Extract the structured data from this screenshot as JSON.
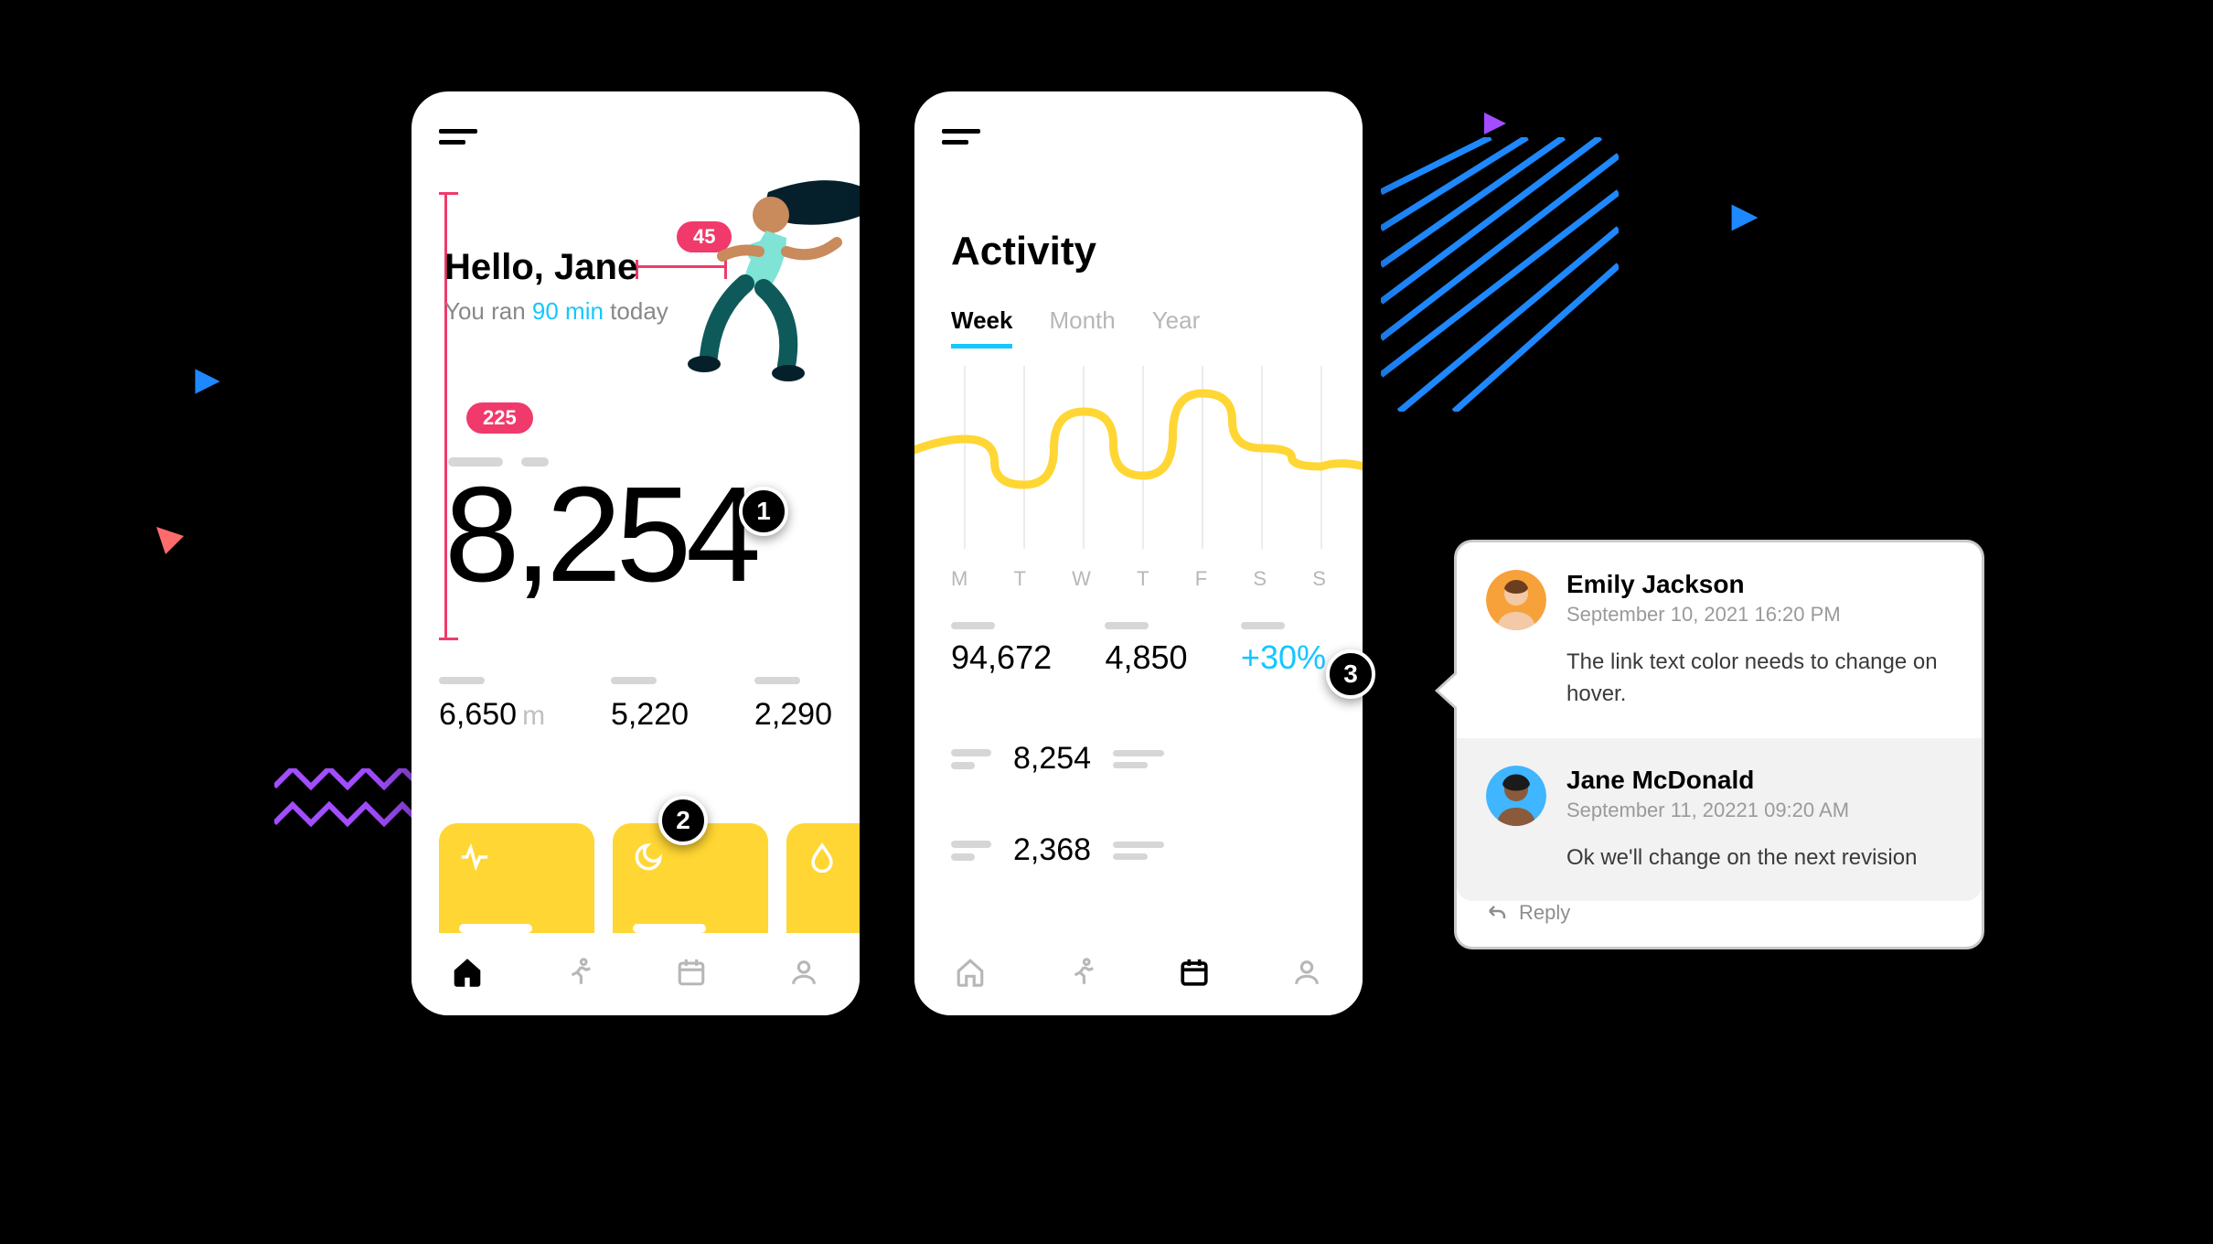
{
  "annotations": {
    "badge45": "45",
    "badge225": "225",
    "markers": {
      "m1": "1",
      "m2": "2",
      "m3": "3"
    }
  },
  "phone1": {
    "greeting_prefix": "Hello, ",
    "greeting_name": "Jane",
    "ran_pre": "You ran ",
    "ran_value": "90 min",
    "ran_post": " today",
    "step_count": "8,254",
    "stats": [
      {
        "value": "6,650",
        "unit": "m"
      },
      {
        "value": "5,220",
        "unit": ""
      },
      {
        "value": "2,290",
        "unit": ""
      }
    ],
    "cards": [
      {
        "icon": "heartbeat-icon"
      },
      {
        "icon": "moon-icon"
      },
      {
        "icon": "droplet-icon"
      }
    ],
    "tabs": [
      "home-icon",
      "run-icon",
      "calendar-icon",
      "user-icon"
    ],
    "active_tab": 0
  },
  "phone2": {
    "title": "Activity",
    "range_tabs": [
      "Week",
      "Month",
      "Year"
    ],
    "active_range": 0,
    "day_labels": [
      "M",
      "T",
      "W",
      "T",
      "F",
      "S",
      "S"
    ],
    "summary": [
      {
        "value": "94,672"
      },
      {
        "value": "4,850"
      },
      {
        "value": "+30%",
        "accent": true
      }
    ],
    "list": [
      {
        "value": "8,254"
      },
      {
        "value": "2,368"
      }
    ],
    "tabs": [
      "home-icon",
      "run-icon",
      "calendar-icon",
      "user-icon"
    ],
    "active_tab": 2
  },
  "comments": {
    "c1": {
      "name": "Emily Jackson",
      "date": "September 10, 2021 16:20 PM",
      "body": "The link text color needs to change on hover."
    },
    "c2": {
      "name": "Jane McDonald",
      "date": "September 11, 20221 09:20 AM",
      "body": "Ok we'll change on the next revision"
    },
    "reply_label": "Reply"
  },
  "chart_data": {
    "type": "line",
    "title": "Activity",
    "xlabel": "",
    "ylabel": "",
    "categories": [
      "M",
      "T",
      "W",
      "T",
      "F",
      "S",
      "S"
    ],
    "values": [
      60,
      35,
      75,
      40,
      85,
      55,
      45
    ],
    "ylim": [
      0,
      100
    ]
  }
}
